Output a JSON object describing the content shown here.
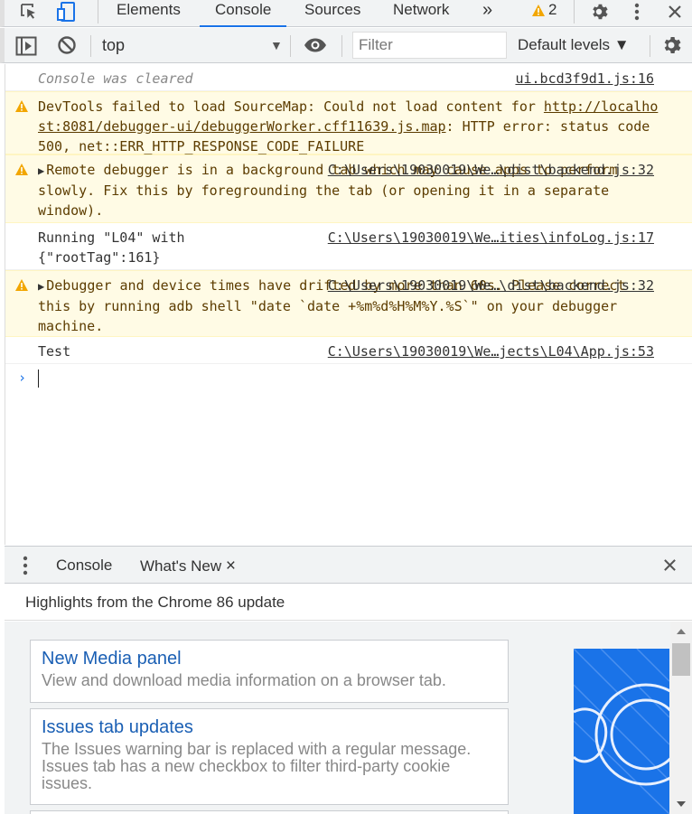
{
  "topbar": {
    "tabs": [
      "Elements",
      "Console",
      "Sources",
      "Network"
    ],
    "more_label": "»",
    "warning_count": "2"
  },
  "toolbar": {
    "context": "top",
    "filter_placeholder": "Filter",
    "levels": "Default levels ▼"
  },
  "console": {
    "messages": [
      {
        "type": "info",
        "text": "Console was cleared",
        "source": "ui.bcd3f9d1.js:16"
      },
      {
        "type": "warn",
        "text_prefix": "DevTools failed to load SourceMap: Could not load content for ",
        "link": "http://localhost:8081/debugger-ui/debuggerWorker.cff11639.js.map",
        "text_suffix": ": HTTP error: status code 500, net::ERR_HTTP_RESPONSE_CODE_FAILURE"
      },
      {
        "type": "warn",
        "text": "Remote debugger is in a background tab which may cause apps to perform slowly. Fix this by foregrounding the tab (or opening it in a separate window).",
        "source": "C:\\Users\\19030019\\We…\\dist\\backend.js:32"
      },
      {
        "type": "log",
        "text": "Running \"L04\" with {\"rootTag\":161}",
        "source": "C:\\Users\\19030019\\We…ities\\infoLog.js:17"
      },
      {
        "type": "warn",
        "text": "Debugger and device times have drifted by more than 60s. Please correct this by running adb shell \"date `date +%m%d%H%M%Y.%S`\" on your debugger machine.",
        "source": "C:\\Users\\19030019\\We…\\dist\\backend.js:32"
      },
      {
        "type": "log",
        "text": "Test",
        "source": "C:\\Users\\19030019\\We…jects\\L04\\App.js:53"
      }
    ],
    "prompt": "›"
  },
  "drawer": {
    "tabs": [
      "Console",
      "What's New"
    ],
    "close_tab": "×",
    "highlights": "Highlights from the Chrome 86 update",
    "cards": [
      {
        "title": "New Media panel",
        "desc": "View and download media information on a browser tab."
      },
      {
        "title": "Issues tab updates",
        "desc": "The Issues warning bar is replaced with a regular message. Issues tab has a new checkbox to filter third-party cookie issues."
      }
    ]
  },
  "colors": {
    "accent": "#1a73e8",
    "warning_bg": "#fffbe5",
    "warning_icon": "#f2a600",
    "link": "#1a5fb4"
  }
}
